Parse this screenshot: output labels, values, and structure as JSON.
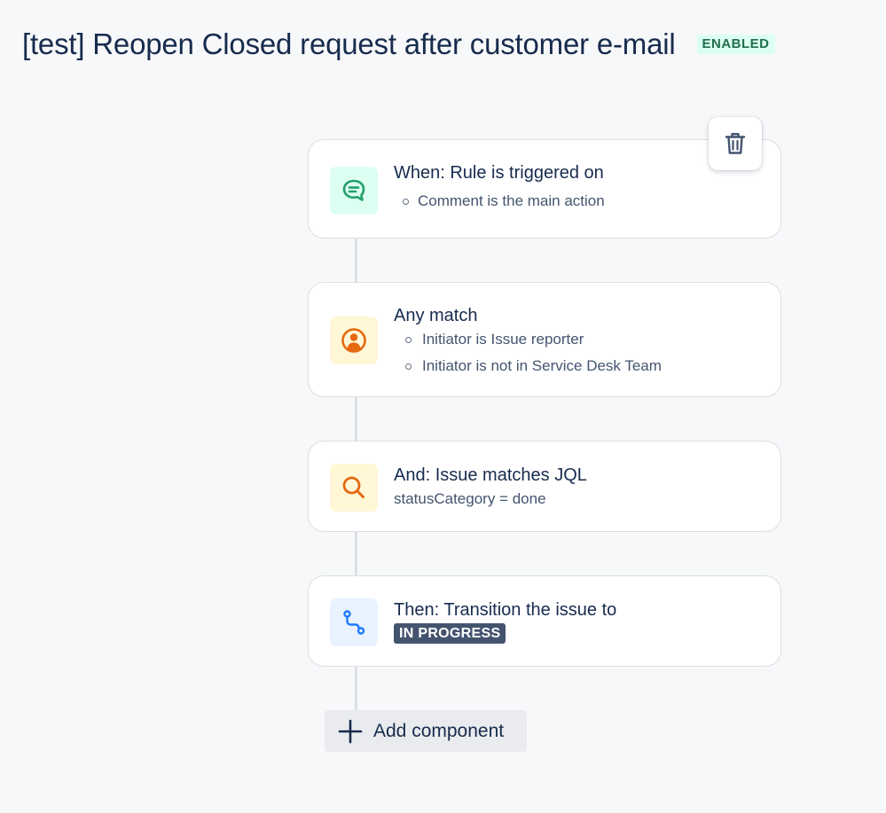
{
  "header": {
    "title": "[test] Reopen Closed request after customer e-mail",
    "status": "ENABLED"
  },
  "rule": {
    "trigger": {
      "title": "When: Rule is triggered on",
      "details": [
        "Comment is the main action"
      ],
      "icon": "comment-icon"
    },
    "condition_any": {
      "title": "Any match",
      "details": [
        "Initiator is Issue reporter",
        "Initiator is not in Service Desk Team"
      ],
      "icon": "person-icon"
    },
    "condition_jql": {
      "title": "And: Issue matches JQL",
      "jql": "statusCategory = done",
      "icon": "search-icon"
    },
    "action": {
      "title": "Then: Transition the issue to",
      "status": "IN PROGRESS",
      "icon": "transition-icon"
    }
  },
  "actions": {
    "add_component_label": "Add component",
    "delete_icon": "trash-icon"
  },
  "colors": {
    "enabled_bg": "#dcfff1",
    "enabled_text": "#216e4e",
    "trigger_icon": "#22a06b",
    "condition_icon": "#e56910",
    "action_icon": "#1d7afc",
    "status_lozenge_bg": "#44546f"
  }
}
